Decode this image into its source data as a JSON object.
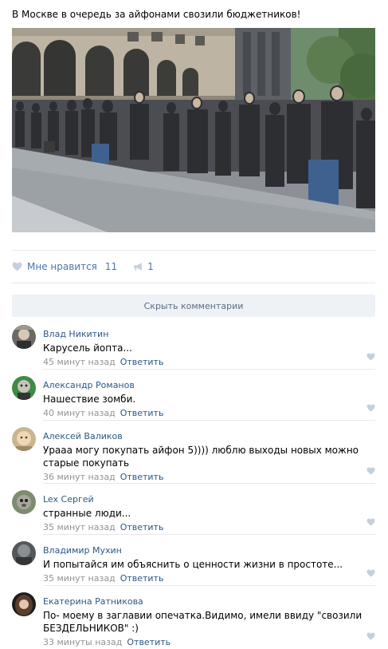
{
  "post": {
    "text": "В Москве в очередь за айфонами свозили бюджетников!",
    "photo_icon": "photo-of-crowd-queue"
  },
  "actions": {
    "like_label": "Мне нравится",
    "like_count": "11",
    "share_count": "1"
  },
  "hide_comments_label": "Скрыть комментарии",
  "reply_label": "Ответить",
  "comments": [
    {
      "author": "Влад Никитин",
      "text": "Карусель йопта...",
      "time": "45 минут назад",
      "avatar": "avatar-vlad"
    },
    {
      "author": "Александр Романов",
      "text": "Нашествие зомби.",
      "time": "40 минут назад",
      "avatar": "avatar-alexandr"
    },
    {
      "author": "Алексей Валиков",
      "text": "Урааа могу покупать айфон 5)))) люблю выходы новых можно старые покупать",
      "time": "36 минут назад",
      "avatar": "avatar-aleksey"
    },
    {
      "author": "Lex Сергей",
      "text": "странные люди...",
      "time": "35 минут назад",
      "avatar": "avatar-lex"
    },
    {
      "author": "Владимир Мухин",
      "text": "И попытайся им объяснить о ценности жизни в простоте...",
      "time": "35 минут назад",
      "avatar": "avatar-vladimir"
    },
    {
      "author": "Екатерина Ратникова",
      "text": "По- моему в заглавии опечатка.Видимо, имели ввиду \"свозили БЕЗДЕЛЬНИКОВ\" :)",
      "time": "33 минуты назад",
      "avatar": "avatar-ekaterina"
    }
  ],
  "colors": {
    "link": "#2a5885",
    "accent": "#4a76a8",
    "muted": "#939393",
    "icon_gray": "#c5d0db"
  }
}
